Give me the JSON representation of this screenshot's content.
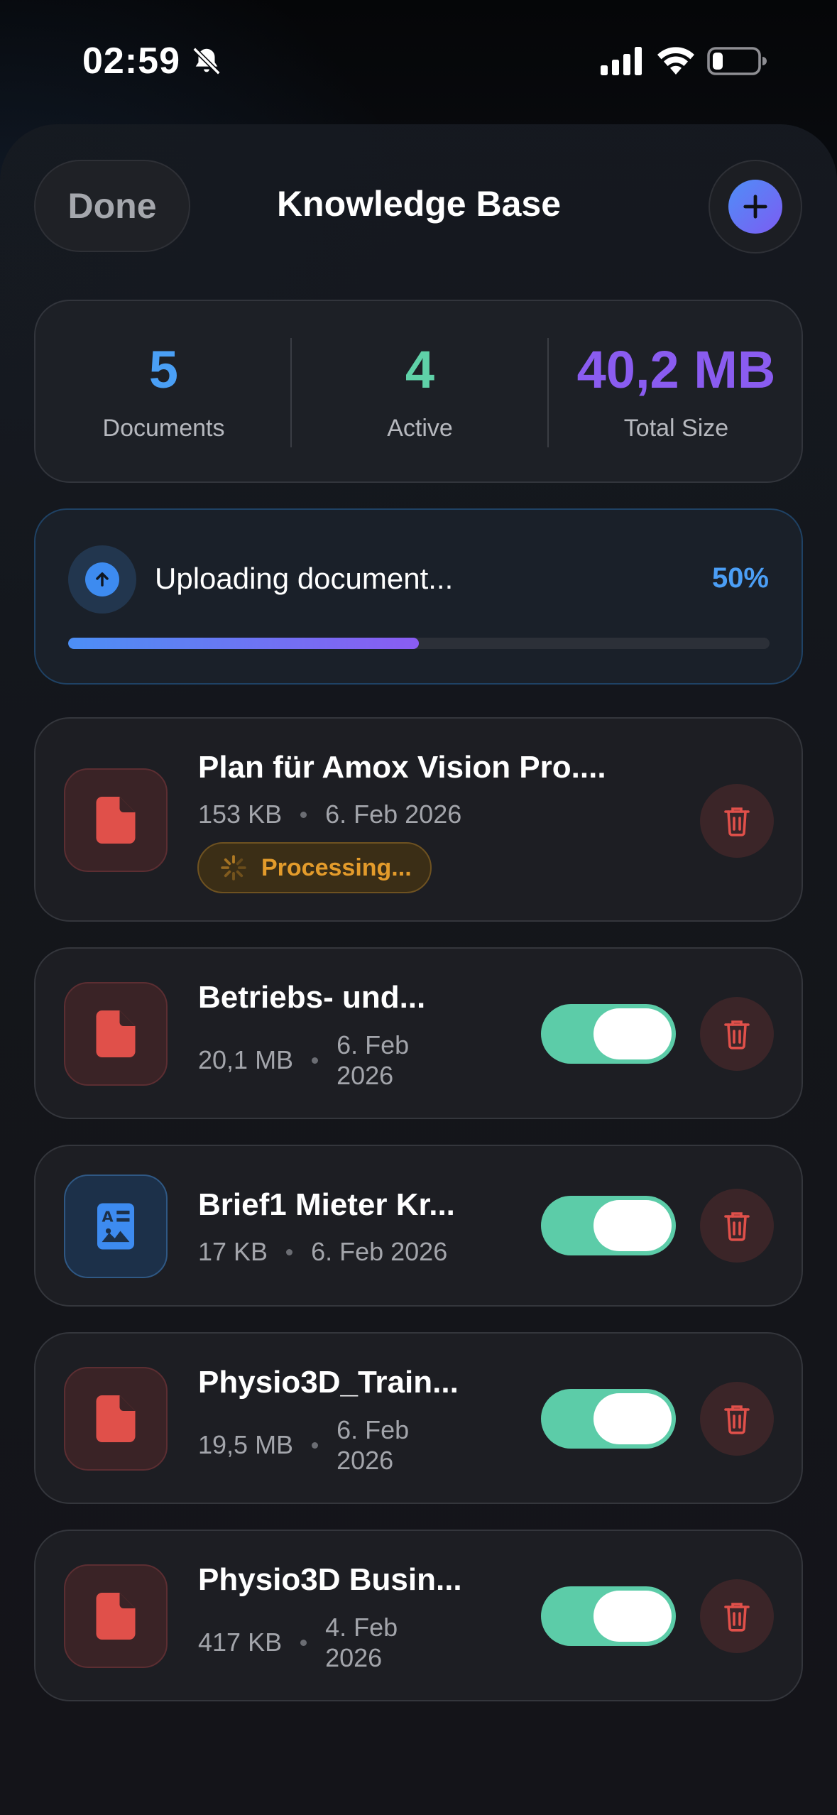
{
  "status_bar": {
    "time": "02:59",
    "icons": [
      "bell-slash-icon",
      "cellular-signal-icon",
      "wifi-icon",
      "battery-icon"
    ]
  },
  "header": {
    "done_label": "Done",
    "title": "Knowledge Base",
    "add_icon": "plus-icon"
  },
  "stats": [
    {
      "value": "5",
      "label": "Documents",
      "color": "#4a9ff5"
    },
    {
      "value": "4",
      "label": "Active",
      "color": "#5fd1a8"
    },
    {
      "value": "40,2 MB",
      "label": "Total Size",
      "color": "#8a5cf0"
    }
  ],
  "upload": {
    "icon": "upload-arrow-icon",
    "text": "Uploading document...",
    "percent_label": "50%",
    "progress": 0.5
  },
  "documents": [
    {
      "name": "Plan für Amox Vision Pro....",
      "size": "153 KB",
      "date": "6. Feb 2026",
      "icon": "pdf-document-icon",
      "status": "Processing...",
      "active": null
    },
    {
      "name": "Betriebs- und...",
      "size": "20,1 MB",
      "date_line1": "6. Feb",
      "date_line2": "2026",
      "icon": "pdf-document-icon",
      "active": true
    },
    {
      "name": "Brief1 Mieter Kr...",
      "size": "17 KB",
      "date": "6. Feb 2026",
      "icon": "image-document-icon",
      "active": true
    },
    {
      "name": "Physio3D_Train...",
      "size": "19,5 MB",
      "date_line1": "6. Feb",
      "date_line2": "2026",
      "icon": "pdf-document-icon",
      "active": true
    },
    {
      "name": "Physio3D Busin...",
      "size": "417 KB",
      "date_line1": "4. Feb",
      "date_line2": "2026",
      "icon": "pdf-document-icon",
      "active": true
    }
  ],
  "colors": {
    "accent_blue": "#4a9ff5",
    "accent_green": "#5fd1a8",
    "accent_purple": "#8a5cf0",
    "processing_orange": "#e39b2b",
    "delete_red": "#e0504a"
  }
}
